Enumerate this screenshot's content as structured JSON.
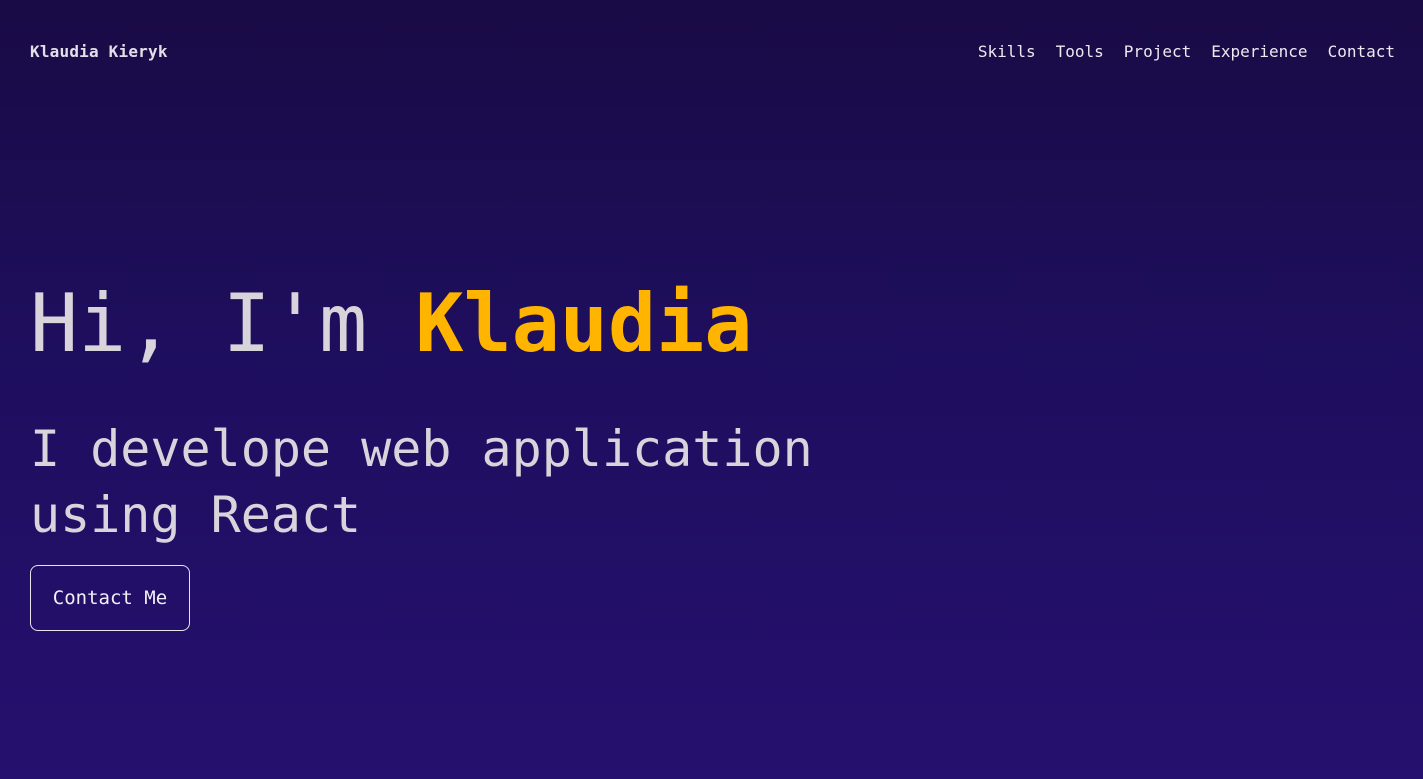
{
  "header": {
    "brand": "Klaudia Kieryk",
    "nav": [
      {
        "label": "Skills"
      },
      {
        "label": "Tools"
      },
      {
        "label": "Project"
      },
      {
        "label": "Experience"
      },
      {
        "label": "Contact"
      }
    ]
  },
  "hero": {
    "greeting": "Hi, I'm ",
    "name": "Klaudia",
    "subtitle": "I develope web application using React",
    "cta_label": "Contact Me"
  },
  "colors": {
    "accent": "#ffb400",
    "background_top": "#190b45",
    "background_bottom": "#26106f",
    "text": "#d8d4db"
  }
}
